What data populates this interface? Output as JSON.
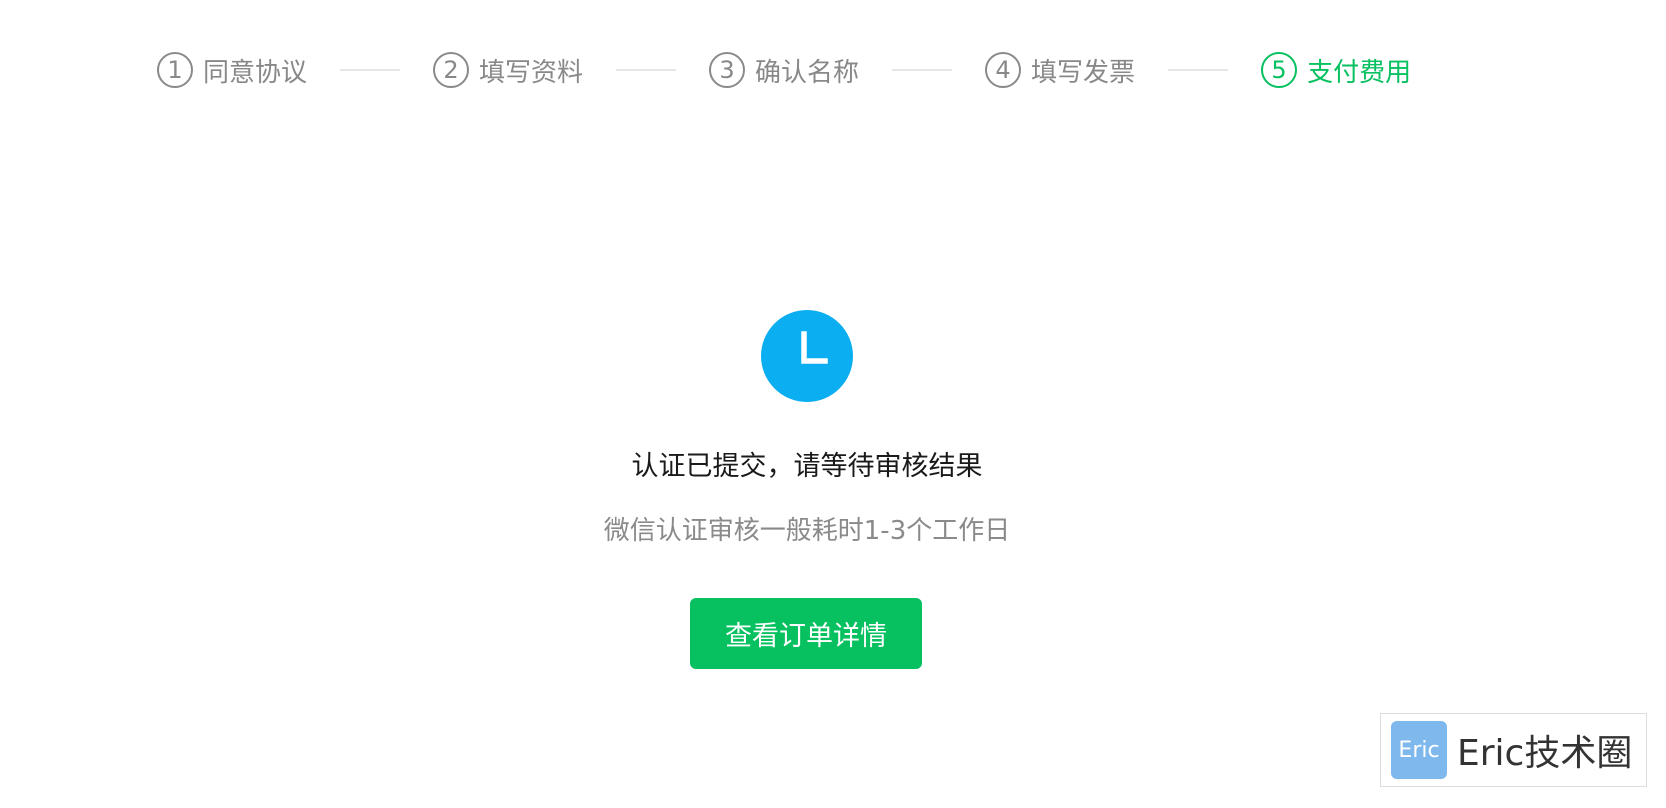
{
  "stepper": {
    "steps": [
      {
        "number": "1",
        "label": "同意协议",
        "active": false
      },
      {
        "number": "2",
        "label": "填写资料",
        "active": false
      },
      {
        "number": "3",
        "label": "确认名称",
        "active": false
      },
      {
        "number": "4",
        "label": "填写发票",
        "active": false
      },
      {
        "number": "5",
        "label": "支付费用",
        "active": true
      }
    ]
  },
  "result": {
    "icon": "clock-icon",
    "title": "认证已提交，请等待审核结果",
    "description": "微信认证审核一般耗时1-3个工作日",
    "button_label": "查看订单详情"
  },
  "watermark": {
    "logo_text": "Eric",
    "text": "Eric技术圈"
  },
  "colors": {
    "accent": "#07c160",
    "icon_background": "#0aaef1",
    "inactive": "#888888",
    "watermark_logo": "#7fb8ec"
  }
}
